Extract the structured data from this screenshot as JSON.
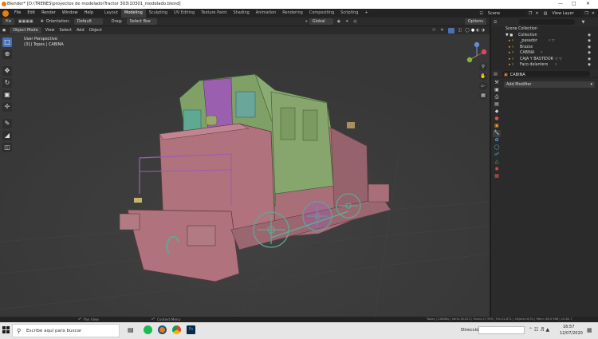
{
  "window": {
    "title": "Blender* [D:\\TRENES\\proyectos de modelado\\Tractor 303\\10301_modelado.blend]"
  },
  "menu": [
    "File",
    "Edit",
    "Render",
    "Window",
    "Help"
  ],
  "workspaces": [
    {
      "label": "Layout",
      "active": false
    },
    {
      "label": "Modeling",
      "active": true
    },
    {
      "label": "Sculpting",
      "active": false
    },
    {
      "label": "UV Editing",
      "active": false
    },
    {
      "label": "Texture Paint",
      "active": false
    },
    {
      "label": "Shading",
      "active": false
    },
    {
      "label": "Animation",
      "active": false
    },
    {
      "label": "Rendering",
      "active": false
    },
    {
      "label": "Compositing",
      "active": false
    },
    {
      "label": "Scripting",
      "active": false
    }
  ],
  "scene": {
    "label": "Scene",
    "view_layer": "View Layer"
  },
  "tool_header": {
    "orientation_label": "Orientation:",
    "orientation_value": "Default",
    "drag_label": "Drag:",
    "drag_value": "Select Box",
    "transform_orientation": "Global",
    "options": "Options"
  },
  "view_header": {
    "mode": "Object Mode",
    "items": [
      "View",
      "Select",
      "Add",
      "Object"
    ]
  },
  "viewport": {
    "perspective": "User Perspective",
    "collection_info": "(31) Topes | CABINA"
  },
  "outliner": {
    "root": "Scene Collection",
    "collection": "Collection",
    "items": [
      "_pasador",
      "Brazos",
      "CABINA",
      "CAJA Y BASTIDOR",
      "Faco delantero"
    ]
  },
  "properties": {
    "object_name": "CABINA",
    "add_modifier": "Add Modifier"
  },
  "statusbar": {
    "pan_view": "Pan View",
    "context_menu": "Context Menu",
    "stats": "Topes | CABINA | Verts:16.813 | Faces:17.955 | Tris:32.871 | Objects:0/31 | Mem: 66.0 MiB | v2.82.7"
  },
  "taskbar": {
    "search_placeholder": "Escribe aquí para buscar",
    "direccion_label": "Dirección",
    "time": "16:57",
    "date": "12/07/2020"
  },
  "colors": {
    "accent": "#4772b3",
    "viewport_bg": "#3b3b3b",
    "body_pink": "#b0727c",
    "cab_green": "#7fa067",
    "wheel_teal": "#5fa892",
    "purple": "#9b5fb0"
  }
}
